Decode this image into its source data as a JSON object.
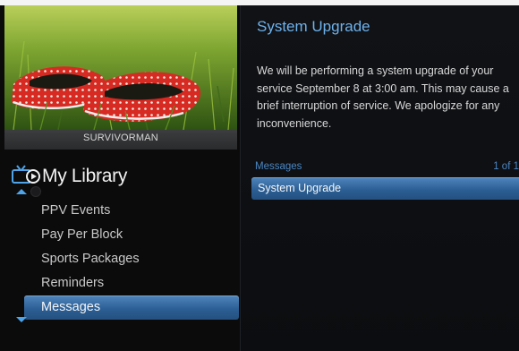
{
  "preview": {
    "caption": "SURVIVORMAN",
    "image_icon": "red-polka-dot-shoes-on-grass-image"
  },
  "library": {
    "title": "My Library",
    "icon": "tv-library-icon",
    "items": [
      {
        "label": "PPV Events",
        "selected": false
      },
      {
        "label": "Pay Per Block",
        "selected": false
      },
      {
        "label": "Sports Packages",
        "selected": false
      },
      {
        "label": "Reminders",
        "selected": false
      },
      {
        "label": "Messages",
        "selected": true
      }
    ]
  },
  "message": {
    "title": "System Upgrade",
    "body": "We will be performing a system upgrade of your service September 8 at 3:00 am. This may cause a brief interruption of service. We apologize for any inconvenience."
  },
  "messages_list": {
    "label": "Messages",
    "count": "1 of 1",
    "items": [
      {
        "label": "System Upgrade",
        "selected": true
      }
    ]
  },
  "colors": {
    "accent": "#6fb2ec",
    "selection": "#2c5f95",
    "background": "#0b0b0c"
  }
}
